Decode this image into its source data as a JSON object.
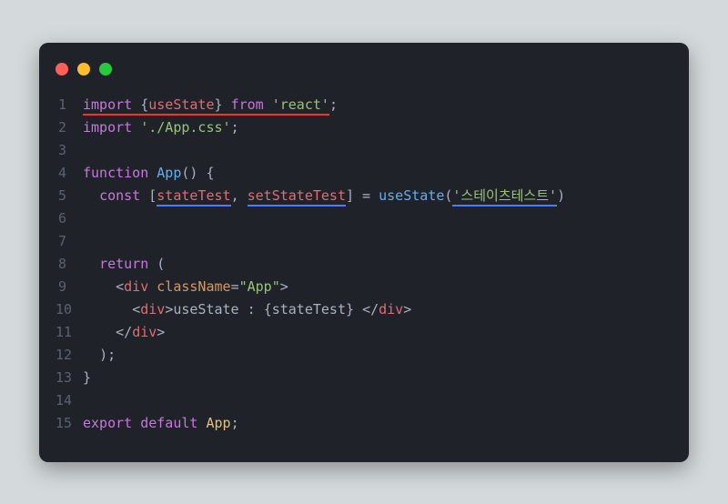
{
  "window": {
    "traffic": [
      "red",
      "yellow",
      "green"
    ]
  },
  "code": {
    "l1": {
      "import": "import",
      "braceOpen": " {",
      "useState": "useState",
      "braceClose": "} ",
      "from": "from",
      "sp": " ",
      "react": "'react'",
      "semi": ";"
    },
    "l2": {
      "import": "import",
      "sp": " ",
      "path": "'./App.css'",
      "semi": ";"
    },
    "l4": {
      "function": "function",
      "sp": " ",
      "name": "App",
      "parens": "()",
      "brace": " {"
    },
    "l5": {
      "indent": "  ",
      "const": "const",
      "sp": " ",
      "openBr": "[",
      "stateTest": "stateTest",
      "comma": ", ",
      "setStateTest": "setStateTest",
      "closeBr": "]",
      "eq": " = ",
      "useStateFn": "useState",
      "openP": "(",
      "arg": "'스테이츠테스트'",
      "closeP": ")"
    },
    "l8": {
      "indent": "  ",
      "return": "return",
      "open": " ("
    },
    "l9": {
      "indent": "    ",
      "lt": "<",
      "div": "div",
      "sp": " ",
      "attr": "className",
      "eq": "=",
      "val": "\"App\"",
      "gt": ">"
    },
    "l10": {
      "indent": "      ",
      "lt": "<",
      "div": "div",
      "gt": ">",
      "text1": "useState : ",
      "braceO": "{",
      "var": "stateTest",
      "braceC": "}",
      "sp": " ",
      "lt2": "</",
      "div2": "div",
      "gt2": ">"
    },
    "l11": {
      "indent": "    ",
      "lt": "</",
      "div": "div",
      "gt": ">"
    },
    "l12": {
      "indent": "  ",
      "close": ");"
    },
    "l13": {
      "close": "}"
    },
    "l15": {
      "export": "export",
      "sp": " ",
      "default": "default",
      "sp2": " ",
      "app": "App",
      "semi": ";"
    }
  },
  "lineNumbers": [
    "1",
    "2",
    "3",
    "4",
    "5",
    "6",
    "7",
    "8",
    "9",
    "10",
    "11",
    "12",
    "13",
    "14",
    "15"
  ]
}
